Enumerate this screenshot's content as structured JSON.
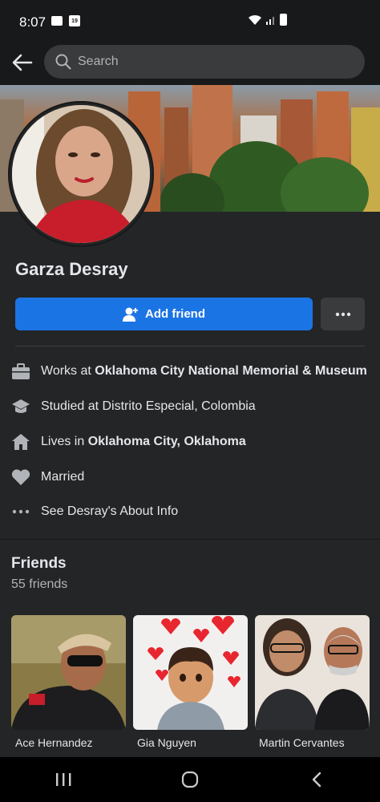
{
  "status_bar": {
    "time": "8:07",
    "calendar_day": "19"
  },
  "search": {
    "placeholder": "Search"
  },
  "profile": {
    "name": "Garza Desray",
    "add_friend_label": "Add friend"
  },
  "about": {
    "work": {
      "prefix": "Works at ",
      "value": "Oklahoma City National Memorial & Museum"
    },
    "education": {
      "text": "Studied at Distrito Especial, Colombia"
    },
    "home": {
      "prefix": "Lives in ",
      "value": "Oklahoma City, Oklahoma"
    },
    "relationship": {
      "text": "Married"
    },
    "see_about": {
      "text": "See Desray's About Info"
    }
  },
  "friends": {
    "title": "Friends",
    "count": "55 friends",
    "items": [
      {
        "name": "Ace Hernandez"
      },
      {
        "name": "Gia Nguyen"
      },
      {
        "name": "Martin Cervantes"
      }
    ]
  },
  "icons": {
    "back": "back-arrow-icon",
    "search": "search-icon",
    "work": "briefcase-icon",
    "education": "graduation-cap-icon",
    "home": "house-icon",
    "relationship": "heart-icon",
    "more": "more-dots-icon"
  },
  "colors": {
    "accent": "#1b74e4",
    "background": "#242526",
    "surface": "#3a3b3c"
  }
}
